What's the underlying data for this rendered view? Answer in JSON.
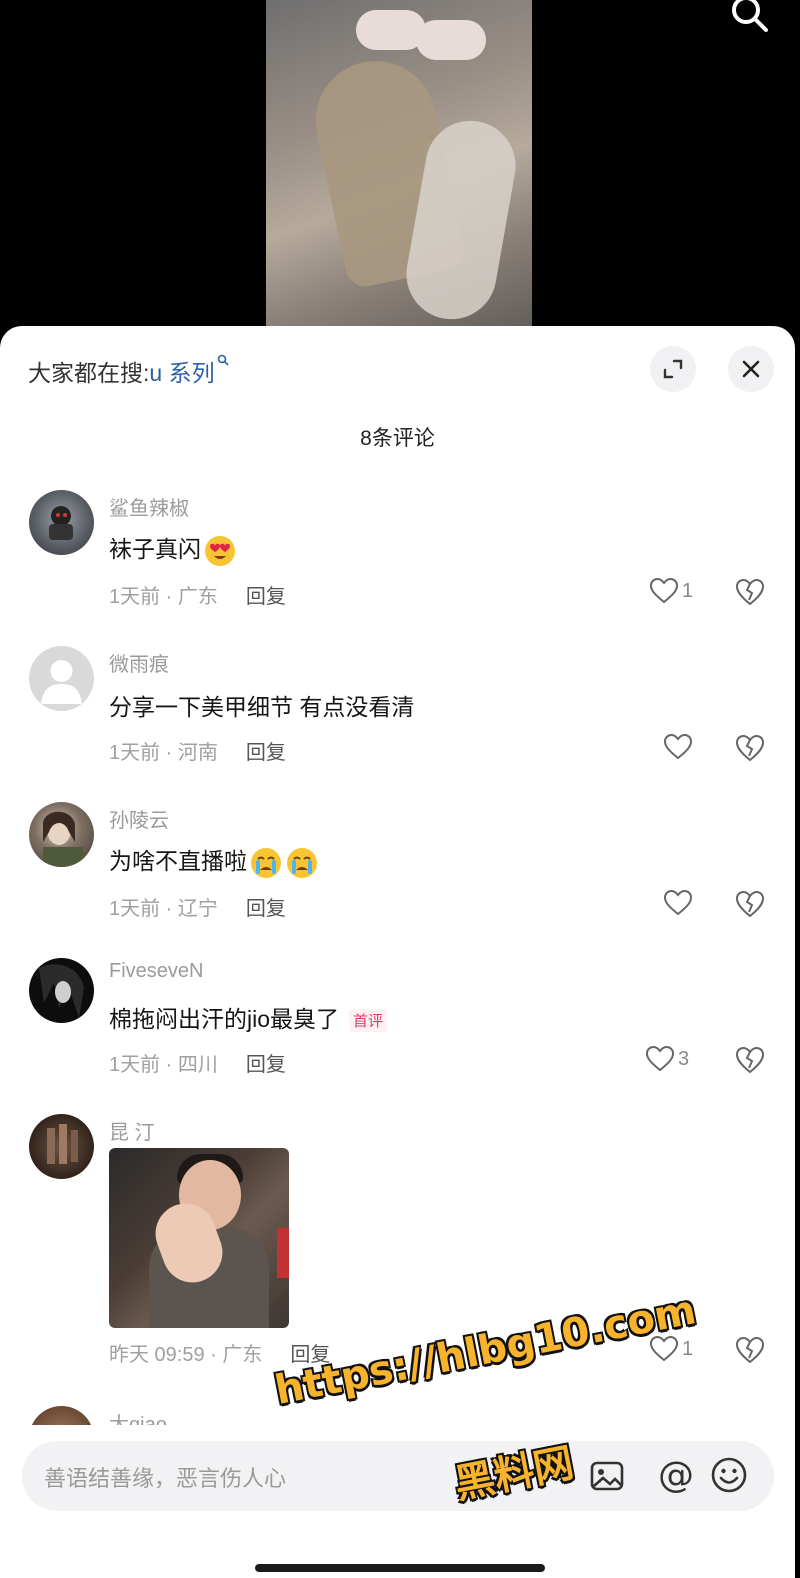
{
  "trending": {
    "prefix": "大家都在搜:",
    "keyword": "u 系列"
  },
  "comment_count": "8条评论",
  "comments": [
    {
      "user": "鲨鱼辣椒",
      "text": "袜子真闪",
      "time_location": "1天前 · 广东",
      "reply": "回复",
      "likes": "1"
    },
    {
      "user": "微雨痕",
      "text": "分享一下美甲细节 有点没看清",
      "time_location": "1天前 · 河南",
      "reply": "回复",
      "likes": ""
    },
    {
      "user": "孙陵云",
      "text": "为啥不直播啦",
      "time_location": "1天前 · 辽宁",
      "reply": "回复",
      "likes": ""
    },
    {
      "user": "FiveseveN",
      "text": "棉拖闷出汗的jio最臭了",
      "tag": "首评",
      "time_location": "1天前 · 四川",
      "reply": "回复",
      "likes": "3"
    },
    {
      "user": "昆 汀",
      "text": "",
      "time_location": "昨天 09:59 · 广东",
      "reply": "回复",
      "likes": "1"
    },
    {
      "user": "大qiao"
    }
  ],
  "input": {
    "placeholder": "善语结善缘，恶言伤人心"
  },
  "watermark": {
    "line1": "https://hlbg10.com",
    "line2": "黑料网"
  },
  "colors": {
    "keyword": "#2c5fa8",
    "first_tag": "#e8386b",
    "watermark": "#f7b32b"
  }
}
